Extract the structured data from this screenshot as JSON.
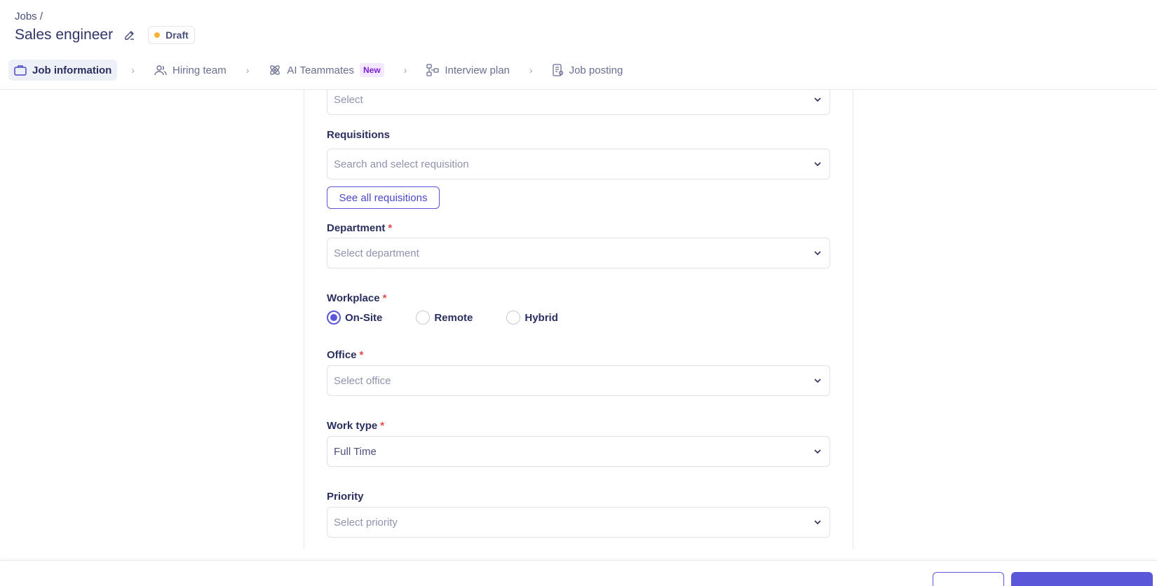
{
  "breadcrumb": "Jobs /",
  "title": "Sales engineer",
  "status": {
    "label": "Draft",
    "color": "#f7b23b"
  },
  "steps": [
    {
      "label": "Job information",
      "icon": "briefcase-icon",
      "active": true
    },
    {
      "label": "Hiring team",
      "icon": "users-icon"
    },
    {
      "label": "AI Teammates",
      "icon": "atom-icon",
      "badge": "New"
    },
    {
      "label": "Interview plan",
      "icon": "flow-icon"
    },
    {
      "label": "Job posting",
      "icon": "document-icon"
    }
  ],
  "form": {
    "top_select": {
      "placeholder": "Select"
    },
    "requisitions": {
      "label": "Requisitions",
      "placeholder": "Search and select requisition",
      "button": "See all requisitions"
    },
    "department": {
      "label": "Department",
      "required": "*",
      "placeholder": "Select department"
    },
    "workplace": {
      "label": "Workplace",
      "required": "*",
      "options": [
        "On-Site",
        "Remote",
        "Hybrid"
      ],
      "selected": "On-Site"
    },
    "office": {
      "label": "Office",
      "required": "*",
      "placeholder": "Select office"
    },
    "work_type": {
      "label": "Work type",
      "required": "*",
      "value": "Full Time"
    },
    "priority": {
      "label": "Priority",
      "placeholder": "Select priority"
    }
  },
  "colors": {
    "accent": "#5b57d9",
    "required": "#e5484d",
    "new_badge": "#7b1fd1"
  }
}
